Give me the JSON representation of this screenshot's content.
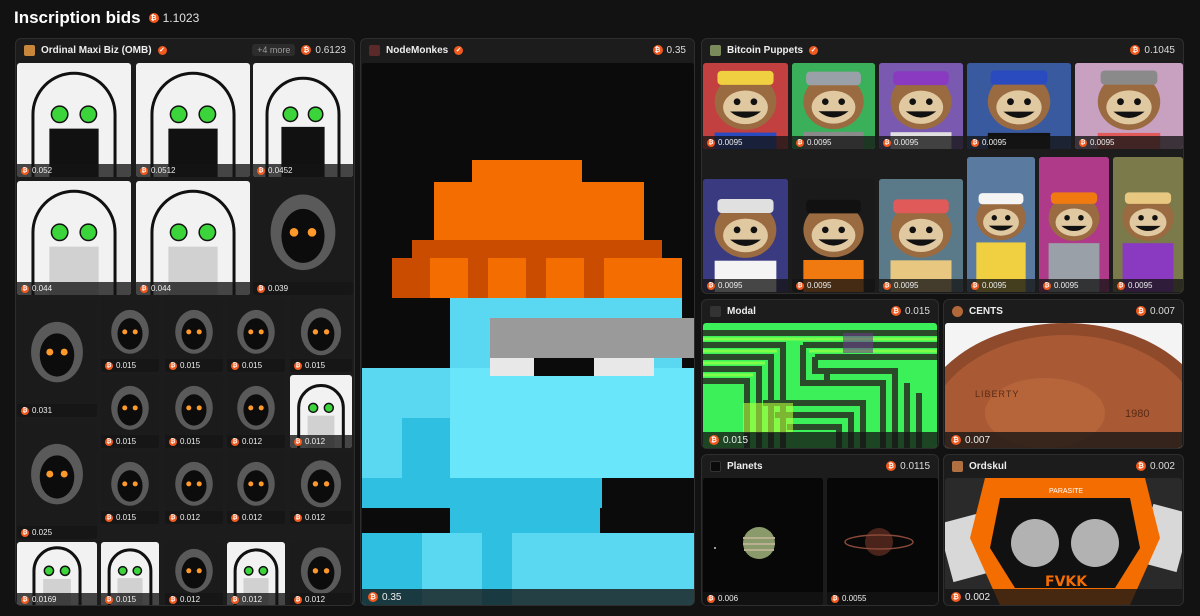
{
  "header": {
    "title": "Inscription bids",
    "total": "1.1023"
  },
  "colors": {
    "accent": "#f05a1e",
    "background": "#121212",
    "panel": "#1c1c1c"
  },
  "omb": {
    "name": "Ordinal Maxi Biz (OMB)",
    "more": "+4 more",
    "price": "0.6123",
    "tiles": [
      "0.052",
      "0.0512",
      "0.0452",
      "0.044",
      "0.044",
      "0.039",
      "0.031",
      "0.015",
      "0.015",
      "0.015",
      "0.015",
      "0.015",
      "0.015",
      "0.012",
      "0.012",
      "0.025",
      "0.015",
      "0.012",
      "0.012",
      "0.012",
      "0.0169",
      "0.015",
      "0.012",
      "0.012",
      "0.012"
    ]
  },
  "nodemonkes": {
    "name": "NodeMonkes",
    "price": "0.35",
    "bid": "0.35"
  },
  "puppets": {
    "name": "Bitcoin Puppets",
    "price": "0.1045",
    "tiles": [
      "0.0095",
      "0.0095",
      "0.0095",
      "0.0095",
      "0.0095",
      "0.0095",
      "0.0095",
      "0.0095",
      "0.0095",
      "0.0095",
      "0.0095"
    ]
  },
  "modal": {
    "name": "Modal",
    "price": "0.015",
    "bid": "0.015"
  },
  "cents": {
    "name": "CENTS",
    "price": "0.007",
    "bid": "0.007",
    "coin_text_1": "LIBERTY",
    "coin_text_2": "1980"
  },
  "planets": {
    "name": "Planets",
    "price": "0.0115",
    "tiles": [
      "0.006",
      "0.0055"
    ]
  },
  "ordskul": {
    "name": "Ordskul",
    "price": "0.002",
    "bid": "0.002",
    "sign_text": "PARASITE",
    "graffiti": "FVKK"
  },
  "icons": [
    "btc-icon",
    "verified-badge-icon",
    "collection-logo-icon"
  ]
}
